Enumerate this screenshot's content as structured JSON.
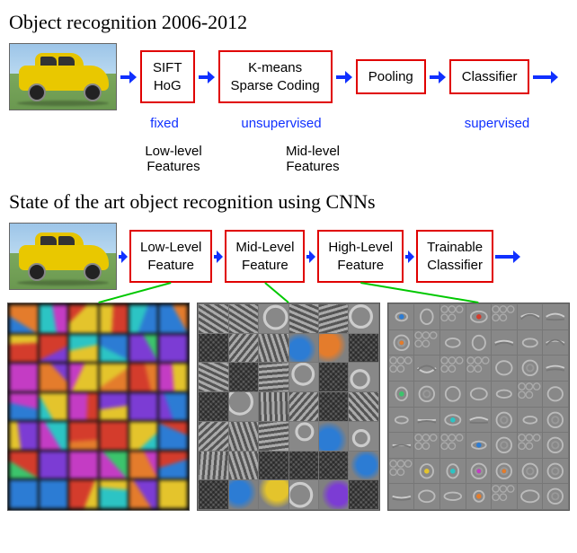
{
  "section1": {
    "title": "Object recognition 2006-2012",
    "boxes": [
      "SIFT\nHoG",
      "K-means\nSparse Coding",
      "Pooling",
      "Classifier"
    ],
    "annotations": [
      "fixed",
      "unsupervised",
      "supervised"
    ],
    "labels": [
      "Low-level\nFeatures",
      "Mid-level\nFeatures"
    ]
  },
  "section2": {
    "title": "State of the art object recognition using CNNs",
    "boxes": [
      "Low-Level\nFeature",
      "Mid-Level\nFeature",
      "High-Level\nFeature",
      "Trainable\nClassifier"
    ]
  }
}
